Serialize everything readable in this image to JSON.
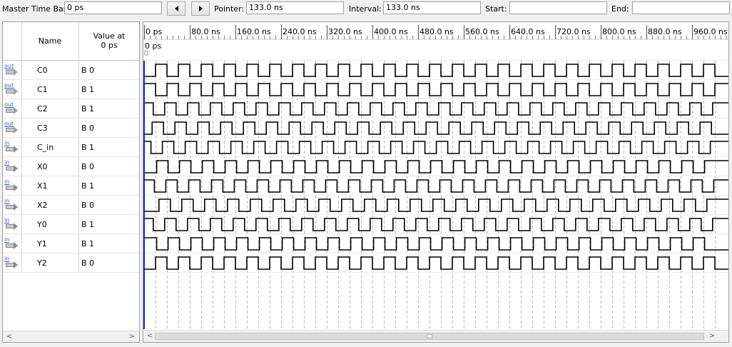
{
  "toolbar": {
    "master_time_bar_label": "Master Time Bar:",
    "master_time_bar_value": "0 ps",
    "pointer_label": "Pointer:",
    "pointer_value": "133.0 ns",
    "interval_label": "Interval:",
    "interval_value": "133.0 ns",
    "start_label": "Start:",
    "start_value": "",
    "end_label": "End:",
    "end_value": ""
  },
  "table": {
    "name_header": "Name",
    "value_header_line1": "Value at",
    "value_header_line2": "0 ps",
    "signals": [
      {
        "dir": "out",
        "name": "C0",
        "value": "B 0"
      },
      {
        "dir": "out",
        "name": "C1",
        "value": "B 1"
      },
      {
        "dir": "out",
        "name": "C2",
        "value": "B 1"
      },
      {
        "dir": "out",
        "name": "C3",
        "value": "B 0"
      },
      {
        "dir": "in",
        "name": "C_in",
        "value": "B 1"
      },
      {
        "dir": "in",
        "name": "X0",
        "value": "B 0"
      },
      {
        "dir": "in",
        "name": "X1",
        "value": "B 1"
      },
      {
        "dir": "in",
        "name": "X2",
        "value": "B 0"
      },
      {
        "dir": "in",
        "name": "Y0",
        "value": "B 1"
      },
      {
        "dir": "in",
        "name": "Y1",
        "value": "B 1"
      },
      {
        "dir": "in",
        "name": "Y2",
        "value": "B 0"
      }
    ]
  },
  "timeline": {
    "ticks": [
      "0 ps",
      "80.0 ns",
      "160.0 ns",
      "240.0 ns",
      "320.0 ns",
      "400.0 ns",
      "480.0 ns",
      "560.0 ns",
      "640.0 ns",
      "720.0 ns",
      "800.0 ns",
      "880.0 ns",
      "960.0 ns"
    ],
    "master_marker_label": "0 ps",
    "period_ns": 40,
    "visible_end_ns": 1000
  },
  "icons": {
    "nav_left": "chevron-left-icon",
    "nav_right": "chevron-right-icon"
  }
}
